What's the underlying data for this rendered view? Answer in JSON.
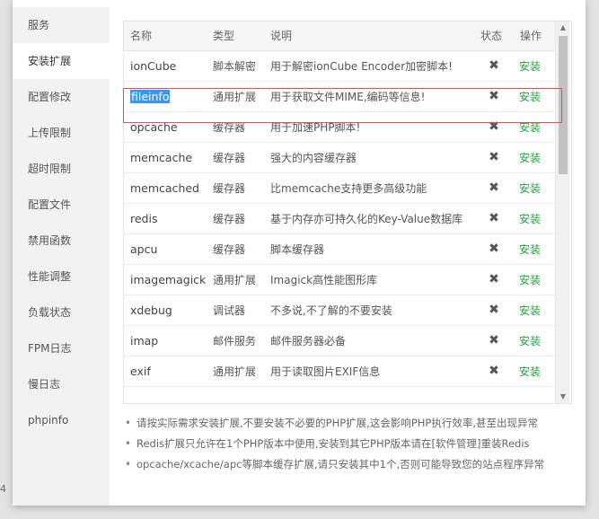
{
  "left_fragment": "4",
  "sidebar": {
    "items": [
      {
        "label": "服务"
      },
      {
        "label": "安装扩展"
      },
      {
        "label": "配置修改"
      },
      {
        "label": "上传限制"
      },
      {
        "label": "超时限制"
      },
      {
        "label": "配置文件"
      },
      {
        "label": "禁用函数"
      },
      {
        "label": "性能调整"
      },
      {
        "label": "负载状态"
      },
      {
        "label": "FPM日志"
      },
      {
        "label": "慢日志"
      },
      {
        "label": "phpinfo"
      }
    ],
    "active_index": 1
  },
  "table": {
    "headers": {
      "name": "名称",
      "type": "类型",
      "desc": "说明",
      "status": "状态",
      "op": "操作"
    },
    "status_icon": "x-icon",
    "rows": [
      {
        "name": "ionCube",
        "type": "脚本解密",
        "desc": "用于解密ionCube Encoder加密脚本!",
        "op": "安装"
      },
      {
        "name": "fileinfo",
        "type": "通用扩展",
        "desc": "用于获取文件MIME,编码等信息!",
        "op": "安装"
      },
      {
        "name": "opcache",
        "type": "缓存器",
        "desc": "用于加速PHP脚本!",
        "op": "安装"
      },
      {
        "name": "memcache",
        "type": "缓存器",
        "desc": "强大的内容缓存器",
        "op": "安装"
      },
      {
        "name": "memcached",
        "type": "缓存器",
        "desc": "比memcache支持更多高级功能",
        "op": "安装"
      },
      {
        "name": "redis",
        "type": "缓存器",
        "desc": "基于内存亦可持久化的Key-Value数据库",
        "op": "安装"
      },
      {
        "name": "apcu",
        "type": "缓存器",
        "desc": "脚本缓存器",
        "op": "安装"
      },
      {
        "name": "imagemagick",
        "type": "通用扩展",
        "desc": "Imagick高性能图形库",
        "op": "安装"
      },
      {
        "name": "xdebug",
        "type": "调试器",
        "desc": "不多说,不了解的不要安装",
        "op": "安装"
      },
      {
        "name": "imap",
        "type": "邮件服务",
        "desc": "邮件服务器必备",
        "op": "安装"
      },
      {
        "name": "exif",
        "type": "通用扩展",
        "desc": "用于读取图片EXIF信息",
        "op": "安装"
      },
      {
        "name": "",
        "type": "",
        "desc": "",
        "op": ""
      }
    ],
    "highlighted_row": 1,
    "selected_text_row": 1
  },
  "notes": [
    "请按实际需求安装扩展,不要安装不必要的PHP扩展,这会影响PHP执行效率,甚至出现异常",
    "Redis扩展只允许在1个PHP版本中使用,安装到其它PHP版本请在[软件管理]重装Redis",
    "opcache/xcache/apc等脚本缓存扩展,请只安装其中1个,否则可能导致您的站点程序异常"
  ],
  "colors": {
    "accent_green": "#20a53a",
    "highlight_red": "#e35050",
    "selection_blue": "#3399ff"
  }
}
